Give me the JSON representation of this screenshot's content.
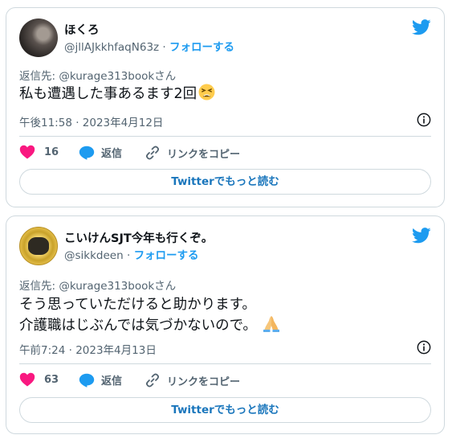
{
  "tweets": [
    {
      "name": "ほくろ",
      "handle": "@jllAJkkhfaqN63z",
      "separator": "·",
      "follow_label": "フォローする",
      "reply_to": "返信先: @kurage313bookさん",
      "text_lines": [
        "私も遭遇した事あるます2回"
      ],
      "emoji": "tired-face-emoji",
      "timestamp": "午後11:58 · 2023年4月12日",
      "likes": "16",
      "reply_label": "返信",
      "copy_link_label": "リンクをコピー",
      "read_more_label": "Twitterでもっと読む"
    },
    {
      "name": "こいけんSJT今年も行くぞ。",
      "handle": "@sikkdeen",
      "separator": "·",
      "follow_label": "フォローする",
      "reply_to": "返信先: @kurage313bookさん",
      "text_lines": [
        "そう思っていただけると助かります。",
        "介護職はじぶんでは気づかないので。"
      ],
      "emoji": "folded-hands-emoji",
      "timestamp": "午前7:24 · 2023年4月13日",
      "likes": "63",
      "reply_label": "返信",
      "copy_link_label": "リンクをコピー",
      "read_more_label": "Twitterでもっと読む"
    }
  ],
  "colors": {
    "accent": "#1d9bf0",
    "like": "#f91880",
    "secondary_text": "#536471",
    "border": "#cfd9de"
  }
}
